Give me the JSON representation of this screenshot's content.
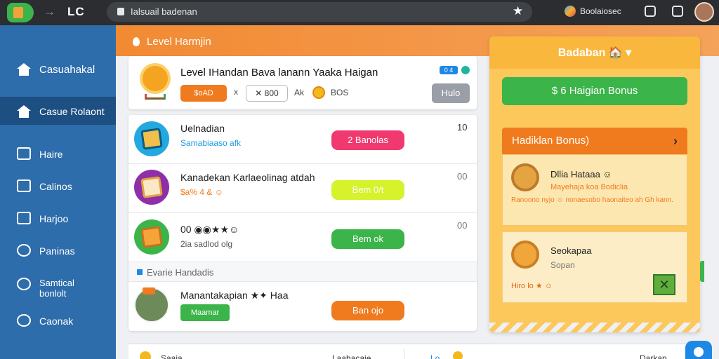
{
  "browser": {
    "brand": "LC",
    "nav_arrow": "→",
    "url": "Ialsuail badenan",
    "star": "★",
    "account": "Boolaiosec",
    "icons": [
      "app-logo-icon",
      "lock-icon",
      "star-icon",
      "account-icon",
      "bookmark-icon",
      "extension-icon",
      "avatar"
    ]
  },
  "sidebar": {
    "items": [
      {
        "label": "Casuahakal",
        "icon": "home-icon"
      },
      {
        "label": "Casue Rolaont",
        "icon": "home-icon",
        "active": true
      },
      {
        "label": "Haire",
        "icon": "building-icon"
      },
      {
        "label": "Calinos",
        "icon": "inbox-icon"
      },
      {
        "label": "Harjoo",
        "icon": "mail-icon"
      },
      {
        "label": "Paninas",
        "icon": "puzzle-icon"
      },
      {
        "label": "Samtical bonlolt",
        "icon": "chat-icon"
      },
      {
        "label": "Caonak",
        "icon": "settings-icon"
      }
    ]
  },
  "header": {
    "title": "Level Harmjin"
  },
  "level_card": {
    "title": "Level IHandan Bava lanann Yaaka Haigan",
    "pill": "$oAD",
    "times": "x",
    "stepper": "✕ 800",
    "text1": "Ak",
    "text2": "BOS",
    "badge": "0 4",
    "button": "Hulo"
  },
  "tasks": [
    {
      "title": "Uelnadian",
      "subtitle": "Samabiaaso afk",
      "count": "10",
      "button": "2 Banolas"
    },
    {
      "title": "Kanadekan Karlaeolinag atdah",
      "subtitle": "$a% 4 & ☺",
      "count": "00",
      "button": "Bem 0/t"
    },
    {
      "title": "00 ◉◉★★☺",
      "subtitle": "2ia sadlod olg",
      "count": "00",
      "button": "Bem ok"
    }
  ],
  "section": {
    "label": "Evarie Handadis"
  },
  "profile_row": {
    "title": "Manantakapian ★✦ Haa",
    "chip": "Maamar",
    "button": "Ban ojo"
  },
  "bonus": {
    "title": "Badaban 🏠",
    "caret": "▾",
    "green_button": "$ 6 Haigian Bonus",
    "section": "Hadiklan Bonus)",
    "chevron": "›",
    "card1": {
      "title": "Dllia Hataaa ☺",
      "subtitle": "Mayehaja koa Bodiclia",
      "desc": "Ranoono nyjo ☺ nonaesobo haonaiteo ah Gh kann."
    },
    "card2": {
      "title": "Seokapaa",
      "subtitle": "Sopan",
      "line": "Hiro lo ★ ☺",
      "close": "✕"
    }
  },
  "bottom": {
    "t1": "Saaia",
    "t2": "Laahacaie",
    "t3": "Lo",
    "t4": "Darkan"
  },
  "colors": {
    "sidebar": "#2e6dab",
    "header_orange": "#f28a33",
    "bonus_yellow": "#fcc85c",
    "accent_green": "#3bb44a",
    "accent_pink": "#f0396f",
    "accent_lime": "#d6f22a"
  }
}
